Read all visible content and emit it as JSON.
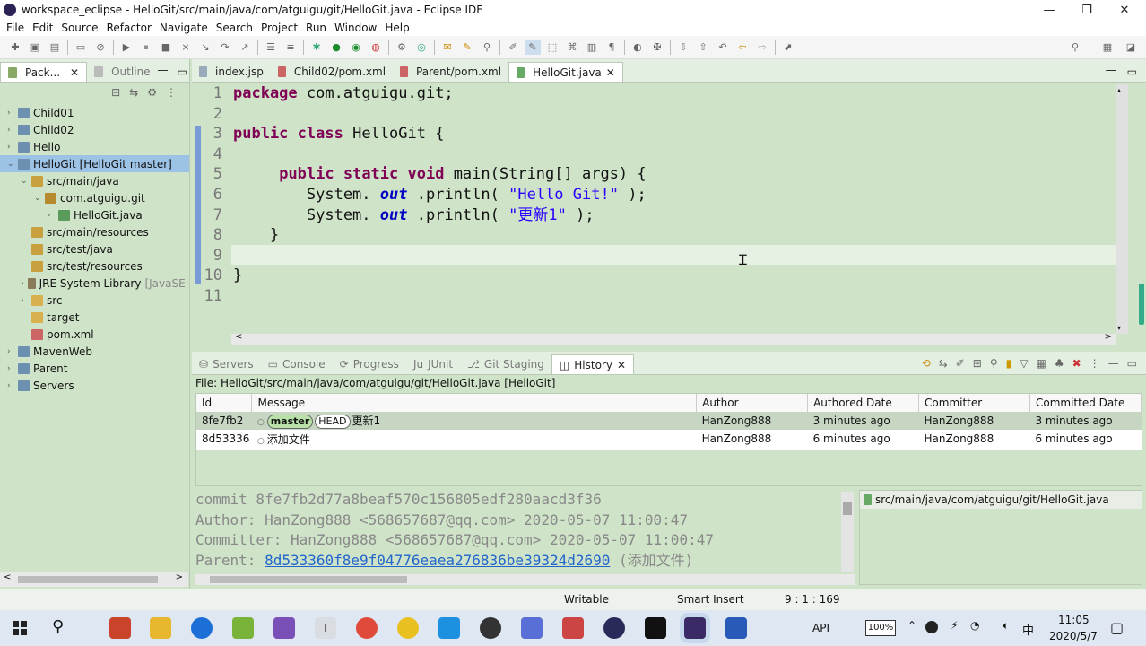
{
  "window": {
    "title": "workspace_eclipse - HelloGit/src/main/java/com/atguigu/git/HelloGit.java - Eclipse IDE"
  },
  "menu": [
    "File",
    "Edit",
    "Source",
    "Refactor",
    "Navigate",
    "Search",
    "Project",
    "Run",
    "Window",
    "Help"
  ],
  "left_tabs": {
    "explorer": "Pack...",
    "outline": "Outline"
  },
  "tree": [
    {
      "label": "Child01",
      "depth": 0,
      "icon": "project-icon",
      "arrow": ">"
    },
    {
      "label": "Child02",
      "depth": 0,
      "icon": "project-icon",
      "arrow": ">"
    },
    {
      "label": "Hello",
      "depth": 0,
      "icon": "project-icon",
      "arrow": ">"
    },
    {
      "label": "HelloGit [HelloGit master]",
      "depth": 0,
      "icon": "project-icon",
      "arrow": "v",
      "selected": true
    },
    {
      "label": "src/main/java",
      "depth": 1,
      "icon": "source-folder-icon",
      "arrow": "v"
    },
    {
      "label": "com.atguigu.git",
      "depth": 2,
      "icon": "package-icon",
      "arrow": "v"
    },
    {
      "label": "HelloGit.java",
      "depth": 3,
      "icon": "java-file-icon",
      "arrow": ">"
    },
    {
      "label": "src/main/resources",
      "depth": 1,
      "icon": "source-folder-icon",
      "arrow": ""
    },
    {
      "label": "src/test/java",
      "depth": 1,
      "icon": "source-folder-icon",
      "arrow": ""
    },
    {
      "label": "src/test/resources",
      "depth": 1,
      "icon": "source-folder-icon",
      "arrow": ""
    },
    {
      "label": "JRE System Library",
      "suffix": "[JavaSE-",
      "depth": 1,
      "icon": "library-icon",
      "arrow": ">"
    },
    {
      "label": "src",
      "depth": 1,
      "icon": "folder-icon",
      "arrow": ">"
    },
    {
      "label": "target",
      "depth": 1,
      "icon": "folder-icon",
      "arrow": ""
    },
    {
      "label": "pom.xml",
      "depth": 1,
      "icon": "xml-file-icon",
      "arrow": ""
    },
    {
      "label": "MavenWeb",
      "depth": 0,
      "icon": "project-icon",
      "arrow": ">"
    },
    {
      "label": "Parent",
      "depth": 0,
      "icon": "project-icon",
      "arrow": ">"
    },
    {
      "label": "Servers",
      "depth": 0,
      "icon": "project-icon",
      "arrow": ">"
    }
  ],
  "editor_tabs": [
    "index.jsp",
    "Child02/pom.xml",
    "Parent/pom.xml",
    "HelloGit.java"
  ],
  "code_lines": [
    {
      "n": "1",
      "t": [
        [
          "kw",
          "package"
        ],
        [
          "",
          "com.atguigu.git;"
        ]
      ]
    },
    {
      "n": "2",
      "t": []
    },
    {
      "n": "3",
      "t": [
        [
          "kw",
          "public class"
        ],
        [
          "",
          "HelloGit {"
        ]
      ]
    },
    {
      "n": "4",
      "t": []
    },
    {
      "n": "5",
      "t": [
        [
          "",
          "    "
        ],
        [
          "kw",
          "public static void"
        ],
        [
          "",
          "main(String[] args) {"
        ]
      ]
    },
    {
      "n": "6",
      "t": [
        [
          "",
          "        System."
        ],
        [
          "it",
          "out"
        ],
        [
          "",
          ".println("
        ],
        [
          "str",
          "\"Hello Git!\""
        ],
        [
          "",
          ");"
        ]
      ]
    },
    {
      "n": "7",
      "t": [
        [
          "",
          "        System."
        ],
        [
          "it",
          "out"
        ],
        [
          "",
          ".println("
        ],
        [
          "str",
          "\"更新1\""
        ],
        [
          "",
          ");"
        ]
      ]
    },
    {
      "n": "8",
      "t": [
        [
          "",
          "    }"
        ]
      ]
    },
    {
      "n": "9",
      "t": []
    },
    {
      "n": "10",
      "t": [
        [
          "",
          "}"
        ]
      ]
    },
    {
      "n": "11",
      "t": []
    }
  ],
  "bottom_tabs": [
    "Servers",
    "Console",
    "Progress",
    "JUnit",
    "Git Staging",
    "History"
  ],
  "history": {
    "file": "File: HelloGit/src/main/java/com/atguigu/git/HelloGit.java [HelloGit]",
    "columns": [
      "Id",
      "Message",
      "Author",
      "Authored Date",
      "Committer",
      "Committed Date"
    ],
    "rows": [
      {
        "id": "8fe7fb2",
        "badges": [
          "master",
          "HEAD"
        ],
        "message": "更新1",
        "author": "HanZong888",
        "authored": "3 minutes ago",
        "committer": "HanZong888",
        "committed": "3 minutes ago"
      },
      {
        "id": "8d53336",
        "badges": [],
        "message": "添加文件",
        "author": "HanZong888",
        "authored": "6 minutes ago",
        "committer": "HanZong888",
        "committed": "6 minutes ago"
      }
    ]
  },
  "commit": {
    "line1": "commit 8fe7fb2d77a8beaf570c156805edf280aacd3f36",
    "line2": "Author: HanZong888 <568657687@qq.com> 2020-05-07 11:00:47",
    "line3": "Committer: HanZong888 <568657687@qq.com> 2020-05-07 11:00:47",
    "parent_label": "Parent:",
    "parent_hash": "8d533360f8e9f04776eaea276836be39324d2690",
    "parent_msg": "(添加文件)",
    "changed_file": "src/main/java/com/atguigu/git/HelloGit.java"
  },
  "status": {
    "writable": "Writable",
    "insert": "Smart Insert",
    "pos": "9 : 1 : 169"
  },
  "taskbar": {
    "time": "11:05",
    "date": "2020/5/7",
    "battery": "100%",
    "ime": "中",
    "api": "API"
  }
}
